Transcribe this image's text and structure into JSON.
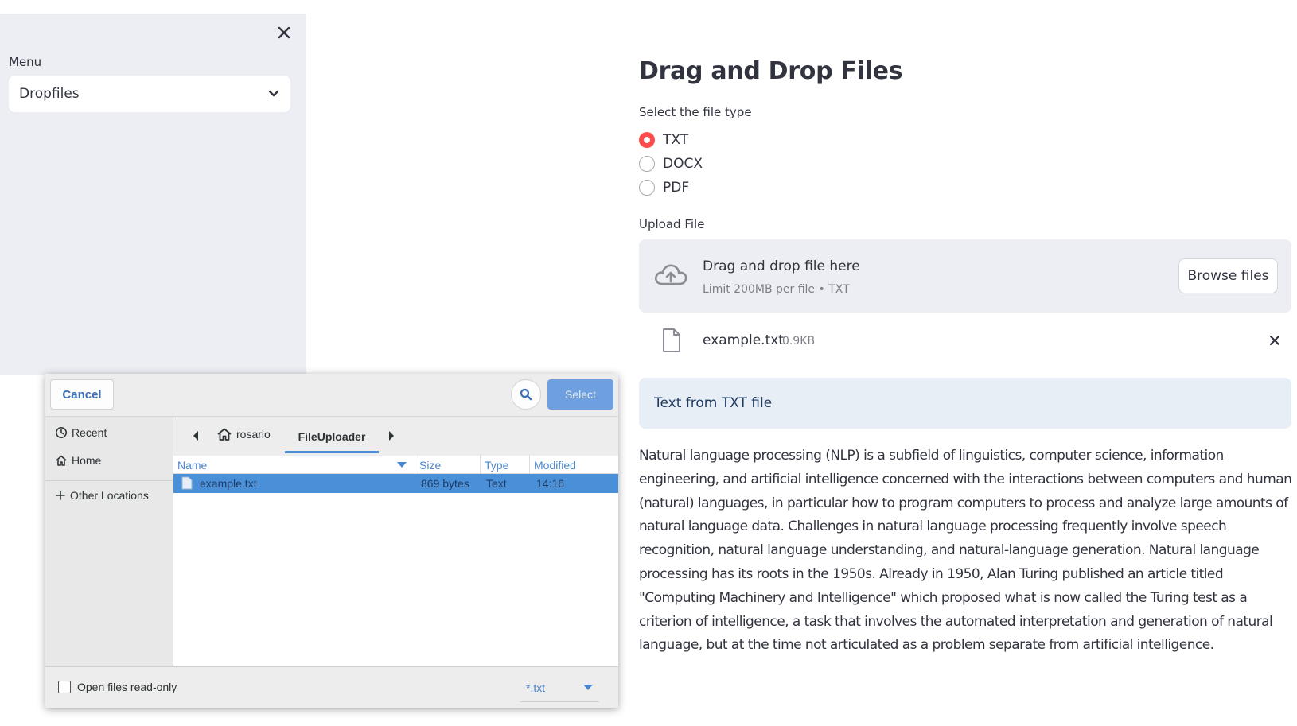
{
  "sidebar": {
    "menu_label": "Menu",
    "menu_value": "Dropfiles",
    "close_icon": "close-icon",
    "chevron_icon": "chevron-down-icon"
  },
  "main": {
    "title": "Drag and Drop Files",
    "filetype_label": "Select the file type",
    "filetype_options": [
      {
        "label": "TXT",
        "checked": true
      },
      {
        "label": "DOCX",
        "checked": false
      },
      {
        "label": "PDF",
        "checked": false
      }
    ],
    "upload_label": "Upload File",
    "dropzone": {
      "title": "Drag and drop file here",
      "subtitle": "Limit 200MB per file • TXT",
      "browse_label": "Browse files",
      "icon": "cloud-upload-icon"
    },
    "uploaded_file": {
      "name": "example.txt",
      "size": "0.9KB",
      "icon": "file-icon"
    },
    "info_text": "Text from TXT file",
    "body_text": "Natural language processing (NLP) is a subfield of linguistics, computer science, information engineering, and artificial intelligence concerned with the interactions between computers and human (natural) languages, in particular how to program computers to process and analyze large amounts of natural language data. Challenges in natural language processing frequently involve speech recognition, natural language understanding, and natural-language generation. Natural language processing has its roots in the 1950s. Already in 1950, Alan Turing published an article titled \"Computing Machinery and Intelligence\" which proposed what is now called the Turing test as a criterion of intelligence, a task that involves the automated interpretation and generation of natural language, but at the time not articulated as a problem separate from artificial intelligence.",
    "accent_color": "#ff4b4b"
  },
  "dialog": {
    "cancel_label": "Cancel",
    "select_label": "Select",
    "places": [
      "Recent",
      "Home",
      "Other Locations"
    ],
    "breadcrumbs": {
      "home": "rosario",
      "current": "FileUploader"
    },
    "columns": [
      "Name",
      "Size",
      "Type",
      "Modified"
    ],
    "rows": [
      {
        "name": "example.txt",
        "size": "869 bytes",
        "type": "Text",
        "modified": "14:16"
      }
    ],
    "readonly_label": "Open files read-only",
    "filter_value": "*.txt",
    "selection_color": "#4a90d9"
  }
}
